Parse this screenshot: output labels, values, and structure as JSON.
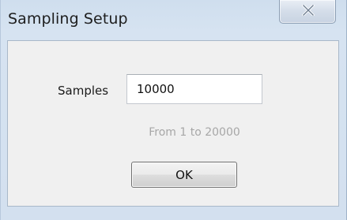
{
  "window": {
    "title": "Sampling Setup"
  },
  "icons": {
    "close": "close-icon"
  },
  "form": {
    "samples_label": "Samples",
    "samples_value": "10000",
    "range_hint": "From 1 to 20000",
    "ok_label": "OK"
  },
  "colors": {
    "title_bar": "#cfdeee",
    "client_area": "#f0f0f0",
    "hint_text": "#a7a7a7"
  }
}
